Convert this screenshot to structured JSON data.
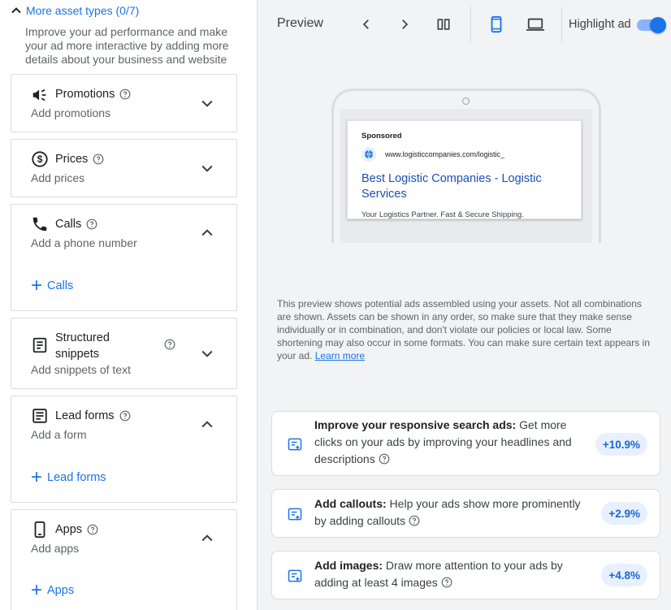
{
  "left_panel": {
    "more_asset_types": "More asset types (0/7)",
    "intro": "Improve your ad performance and make your ad more interactive by adding more details about your business and website",
    "cards": {
      "promotions": {
        "title": "Promotions",
        "subtitle": "Add promotions",
        "icon": "megaphone-icon",
        "state": "collapsed"
      },
      "prices": {
        "title": "Prices",
        "subtitle": "Add prices",
        "icon": "dollar-icon",
        "state": "collapsed"
      },
      "calls": {
        "title": "Calls",
        "subtitle": "Add a phone number",
        "add_label": "Calls",
        "icon": "phone-icon",
        "state": "expanded"
      },
      "structured_snippets": {
        "title_line1": "Structured",
        "title_line2": "snippets",
        "subtitle": "Add snippets of text",
        "icon": "document-icon",
        "state": "collapsed"
      },
      "lead_forms": {
        "title": "Lead forms",
        "subtitle": "Add a form",
        "add_label": "Lead forms",
        "icon": "form-icon",
        "state": "expanded"
      },
      "apps": {
        "title": "Apps",
        "subtitle": "Add apps",
        "add_label": "Apps",
        "icon": "smartphone-icon",
        "state": "expanded"
      }
    }
  },
  "preview": {
    "title": "Preview",
    "highlight_label": "Highlight ad",
    "highlight_on": true,
    "device_selected": "mobile",
    "ad": {
      "sponsored": "Sponsored",
      "url": "www.logisticcompanies.com/logistic_",
      "headline": "Best Logistic Companies - Logistic Services",
      "description": "Your Logistics Partner. Fast & Secure Shipping."
    },
    "note": "This preview shows potential ads assembled using your assets. Not all combinations are shown. Assets can be shown in any order, so make sure that they make sense individually or in combination, and don't violate our policies or local law. Some shortening may also occur in some formats. You can make sure certain text appears in your ad.",
    "learn_more": "Learn more"
  },
  "recommendations": [
    {
      "bold": "Improve your responsive search ads:",
      "text": " Get more clicks on your ads by improving your headlines and descriptions",
      "badge": "+10.9%"
    },
    {
      "bold": "Add callouts:",
      "text": " Help your ads show more prominently by adding callouts",
      "badge": "+2.9%"
    },
    {
      "bold": "Add images:",
      "text": " Draw more attention to your ads by adding at least 4 images",
      "badge": "+4.8%"
    }
  ],
  "colors": {
    "accent": "#1a73e8",
    "badge_bg": "#e8f0fe",
    "panel_bg": "#f1f3f4"
  }
}
